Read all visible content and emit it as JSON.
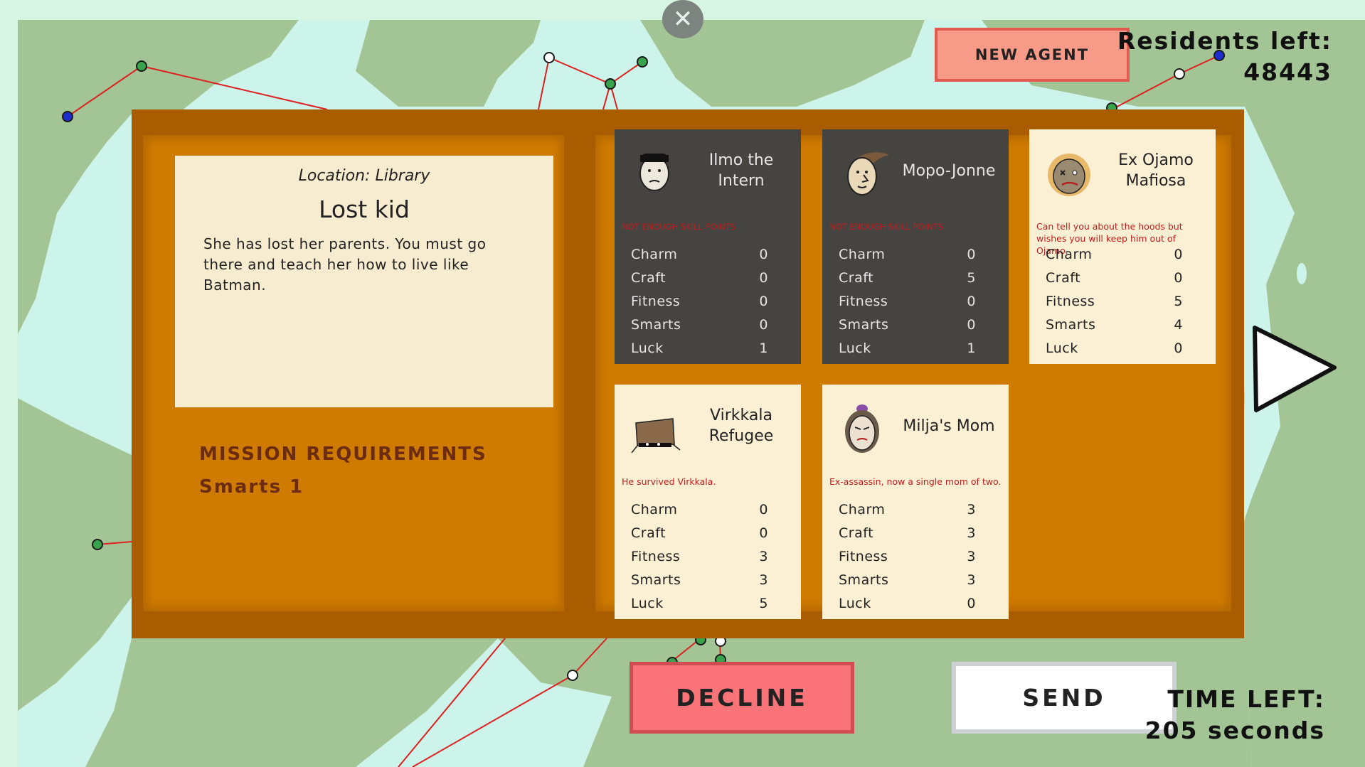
{
  "hud": {
    "new_agent_label": "NEW AGENT",
    "residents_label": "Residents left:",
    "residents_value": "48443",
    "time_left_label": "TIME LEFT:",
    "time_left_value": "205 seconds",
    "close_icon": "close-icon"
  },
  "mission": {
    "location": "Location: Library",
    "title": "Lost kid",
    "description": "She has lost her parents. You must go there and teach her how to live like Batman.",
    "requirements_title": "MISSION REQUIREMENTS",
    "requirements_value": "Smarts 1"
  },
  "stat_labels": [
    "Charm",
    "Craft",
    "Fitness",
    "Smarts",
    "Luck"
  ],
  "agents": [
    {
      "name": "Ilmo the Intern",
      "note": "NOT ENOUGH SKILL POINTS",
      "style": "dark",
      "stats": [
        "0",
        "0",
        "0",
        "0",
        "1"
      ]
    },
    {
      "name": "Mopo-Jonne",
      "note": "NOT ENOUGH SKILL POINTS",
      "style": "dark",
      "stats": [
        "0",
        "5",
        "0",
        "0",
        "1"
      ]
    },
    {
      "name": "Ex Ojamo Mafiosa",
      "note": "Can tell you about the hoods but wishes you will keep him out of Ojamo.",
      "style": "light",
      "stats": [
        "0",
        "0",
        "5",
        "4",
        "0"
      ]
    },
    {
      "name": "Virkkala Refugee",
      "note": "He survived Virkkala.",
      "style": "light",
      "stats": [
        "0",
        "0",
        "3",
        "3",
        "5"
      ]
    },
    {
      "name": "Milja's Mom",
      "note": "Ex-assassin, now a single mom of two.",
      "style": "light",
      "stats": [
        "3",
        "3",
        "3",
        "3",
        "0"
      ]
    }
  ],
  "actions": {
    "decline_label": "DECLINE",
    "send_label": "SEND",
    "next_icon": "play-arrow-icon"
  },
  "colors": {
    "map_land": "#a3c595",
    "map_water": "#cdf4ea",
    "panel_outer": "#a95c00",
    "panel_inner": "#cf7b00",
    "card_dark": "#454440",
    "card_light": "#fbefd4",
    "warning_red": "#c21c1c",
    "decline": "#fa7378",
    "new_agent": "#f79a88"
  }
}
